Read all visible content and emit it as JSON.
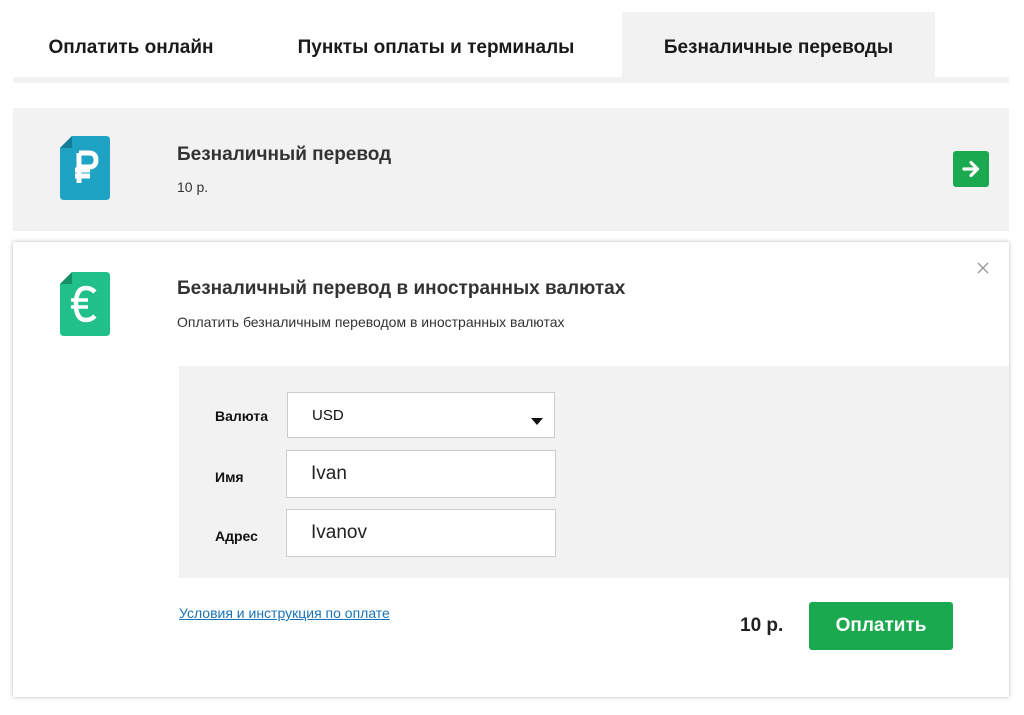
{
  "tabs": [
    {
      "label": "Оплатить онлайн"
    },
    {
      "label": "Пункты оплаты и терминалы"
    },
    {
      "label": "Безналичные переводы"
    }
  ],
  "cards": [
    {
      "icon": "ruble-document-icon",
      "icon_color": "#1fa3c4",
      "title": "Безналичный перевод",
      "subtitle": "10 р."
    },
    {
      "icon": "euro-document-icon",
      "icon_color": "#21c08a",
      "title": "Безналичный перевод в иностранных валютах",
      "subtitle": "Оплатить безналичным переводом в иностранных валютах"
    }
  ],
  "form": {
    "currency_label": "Валюта",
    "currency_value": "USD",
    "name_label": "Имя",
    "name_value": "Ivan",
    "address_label": "Адрес",
    "address_value": "Ivanov"
  },
  "footer": {
    "terms_link": "Условия и инструкция по оплате",
    "total": "10 р.",
    "pay_button": "Оплатить"
  },
  "colors": {
    "accent_green": "#1aa94f",
    "link_blue": "#1a73b8",
    "panel_gray": "#f2f2f2"
  }
}
